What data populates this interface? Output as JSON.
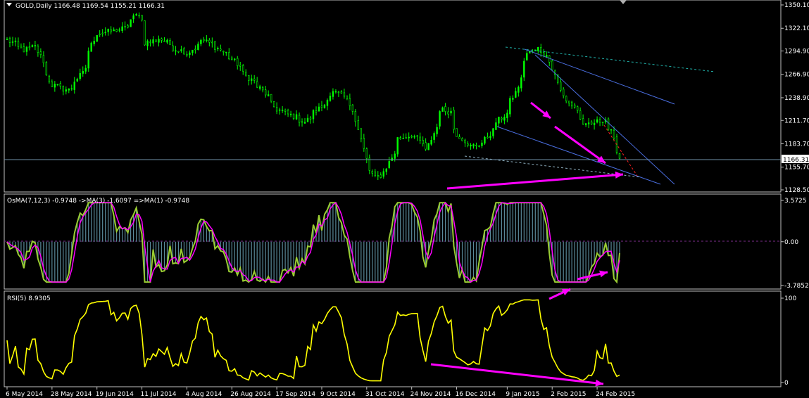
{
  "colors": {
    "background": "#000000",
    "panel_border": "#c0c0c0",
    "grid": "#1e1e1e",
    "candles": "#00ff00",
    "osma_hist": "#5a8a9a",
    "osma_ma3": "#ff00ff",
    "osma_ma1": "#9acd32",
    "rsi_line": "#ffff00",
    "annotation_arrow": "#ff00ff",
    "trend_blue": "#4a6ee0",
    "trend_teal": "#20b2aa",
    "trend_red": "#ff2020",
    "price_line": "#6f8fa8"
  },
  "price_panel": {
    "title": "GOLD,Daily  1166.48 1169.54 1155.21 1166.31",
    "current_price_label": "1166.31",
    "price_ticks": [
      "1350.10",
      "1322.10",
      "1294.90",
      "1266.90",
      "1238.90",
      "1211.70",
      "1183.70",
      "1155.70",
      "1128.50"
    ]
  },
  "osma_panel": {
    "title": "OsMA(7,12,3) -0.9748  ->MA(3) -1.6097  =>MA(1) -0.9748",
    "ticks": [
      "3.5725",
      "0.00",
      "-3.7852"
    ]
  },
  "rsi_panel": {
    "title": "RSI(5) 8.9305",
    "ticks": [
      "100",
      "0"
    ]
  },
  "x_axis": {
    "labels": [
      "6 May 2014",
      "28 May 2014",
      "19 Jun 2014",
      "11 Jul 2014",
      "4 Aug 2014",
      "26 Aug 2014",
      "17 Sep 2014",
      "9 Oct 2014",
      "31 Oct 2014",
      "24 Nov 2014",
      "16 Dec 2014",
      "9 Jan 2015",
      "2 Feb 2015",
      "24 Feb 2015"
    ]
  },
  "chart_data": {
    "type": "candlestick",
    "instrument": "GOLD",
    "timeframe": "Daily",
    "price_axis": {
      "ticks": [
        1350.1,
        1322.1,
        1294.9,
        1266.9,
        1238.9,
        1211.7,
        1183.7,
        1155.7,
        1128.5
      ]
    },
    "close_series": {
      "name": "GOLD close",
      "keypoints": [
        [
          "6 May 2014",
          1308
        ],
        [
          "14 May 2014",
          1296
        ],
        [
          "20 May 2014",
          1300
        ],
        [
          "28 May 2014",
          1254
        ],
        [
          "5 Jun 2014",
          1248
        ],
        [
          "12 Jun 2014",
          1268
        ],
        [
          "19 Jun 2014",
          1316
        ],
        [
          "26 Jun 2014",
          1318
        ],
        [
          "3 Jul 2014",
          1322
        ],
        [
          "10 Jul 2014",
          1340
        ],
        [
          "14 Jul 2014",
          1305
        ],
        [
          "21 Jul 2014",
          1310
        ],
        [
          "28 Jul 2014",
          1298
        ],
        [
          "4 Aug 2014",
          1292
        ],
        [
          "11 Aug 2014",
          1308
        ],
        [
          "18 Aug 2014",
          1300
        ],
        [
          "26 Aug 2014",
          1285
        ],
        [
          "2 Sep 2014",
          1265
        ],
        [
          "9 Sep 2014",
          1250
        ],
        [
          "17 Sep 2014",
          1225
        ],
        [
          "24 Sep 2014",
          1218
        ],
        [
          "1 Oct 2014",
          1210
        ],
        [
          "9 Oct 2014",
          1228
        ],
        [
          "15 Oct 2014",
          1245
        ],
        [
          "21 Oct 2014",
          1240
        ],
        [
          "27 Oct 2014",
          1212
        ],
        [
          "31 Oct 2014",
          1165
        ],
        [
          "5 Nov 2014",
          1143
        ],
        [
          "10 Nov 2014",
          1150
        ],
        [
          "17 Nov 2014",
          1190
        ],
        [
          "24 Nov 2014",
          1195
        ],
        [
          "1 Dec 2014",
          1175
        ],
        [
          "8 Dec 2014",
          1225
        ],
        [
          "12 Dec 2014",
          1222
        ],
        [
          "16 Dec 2014",
          1195
        ],
        [
          "22 Dec 2014",
          1180
        ],
        [
          "29 Dec 2014",
          1185
        ],
        [
          "5 Jan 2015",
          1210
        ],
        [
          "9 Jan 2015",
          1220
        ],
        [
          "14 Jan 2015",
          1245
        ],
        [
          "20 Jan 2015",
          1292
        ],
        [
          "26 Jan 2015",
          1298
        ],
        [
          "2 Feb 2015",
          1275
        ],
        [
          "6 Feb 2015",
          1240
        ],
        [
          "12 Feb 2015",
          1228
        ],
        [
          "18 Feb 2015",
          1205
        ],
        [
          "24 Feb 2015",
          1210
        ],
        [
          "27 Feb 2015",
          1213
        ],
        [
          "3 Mar 2015",
          1198
        ],
        [
          "6 Mar 2015",
          1166
        ]
      ]
    },
    "osma": {
      "range": [
        -3.7852,
        3.5725
      ],
      "last_values": {
        "osma": -0.9748,
        "ma3": -1.6097,
        "ma1": -0.9748
      }
    },
    "rsi": {
      "period": 5,
      "range": [
        0,
        100
      ],
      "last_value": 8.9305
    }
  }
}
